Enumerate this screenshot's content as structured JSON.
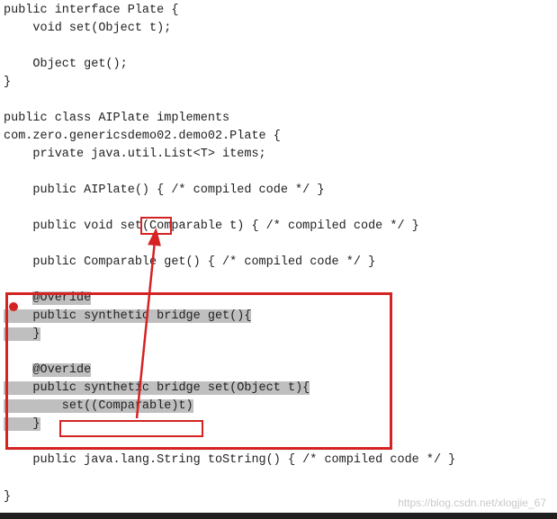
{
  "code": {
    "l01": "public interface Plate {",
    "l02": "    void set(Object t);",
    "l03": "",
    "l04": "    Object get();",
    "l05": "}",
    "l06": "",
    "l07": "public class AIPlate implements",
    "l08": "com.zero.genericsdemo02.demo02.Plate {",
    "l09": "    private java.util.List<T> items;",
    "l10": "",
    "l11": "    public AIPlate() { /* compiled code */ }",
    "l12": "",
    "l13a": "    public void ",
    "l13b": "set",
    "l13c": "(Comparable t) { /* compiled code */ }",
    "l14": "",
    "l15": "    public Comparable get() { /* compiled code */ }",
    "l16": "",
    "l17": "    @Overide",
    "l18a": "    public ",
    "l18b": "synthetic bridge",
    "l18c": " get(){",
    "l19": "    }",
    "l20": "",
    "l21": "    @Overide",
    "l22a": "    public ",
    "l22b": "synthetic bridge",
    "l22c": " set(Object t){",
    "l23": "        set((Comparable)t)",
    "l24": "    }",
    "l25": "",
    "l26": "    public java.lang.String toString() { /* compiled code */ }",
    "lend": "}"
  },
  "watermark": "https://blog.csdn.net/xlogjie_67"
}
